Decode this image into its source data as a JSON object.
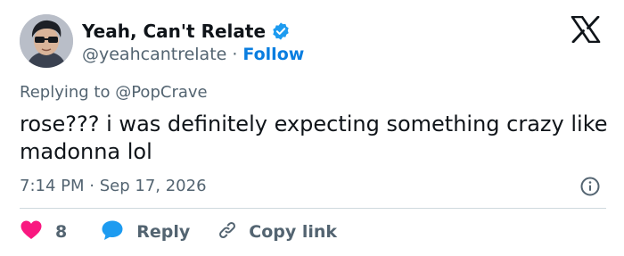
{
  "author": {
    "display_name": "Yeah, Can't Relate",
    "handle": "@yeahcantrelate",
    "separator": "·",
    "follow_label": "Follow",
    "verified": true
  },
  "reply": {
    "prefix": "Replying to",
    "target": "@PopCrave"
  },
  "tweet": {
    "text": "rose??? i was definitely expecting something crazy like madonna lol"
  },
  "meta": {
    "time": "7:14 PM",
    "separator": "·",
    "date": "Sep 17, 2026"
  },
  "actions": {
    "like_count": "8",
    "reply_label": "Reply",
    "copy_label": "Copy link"
  },
  "icons": {
    "verified": "verified-badge-icon",
    "brand": "x-logo-icon",
    "info": "info-icon",
    "like": "heart-icon",
    "reply": "speech-bubble-icon",
    "copy": "link-icon"
  },
  "colors": {
    "text": "#0f1419",
    "secondary": "#536471",
    "accent": "#0a7ee0",
    "like": "#f91880",
    "reply_bubble": "#1d9bf0",
    "divider": "#cfd9de"
  }
}
